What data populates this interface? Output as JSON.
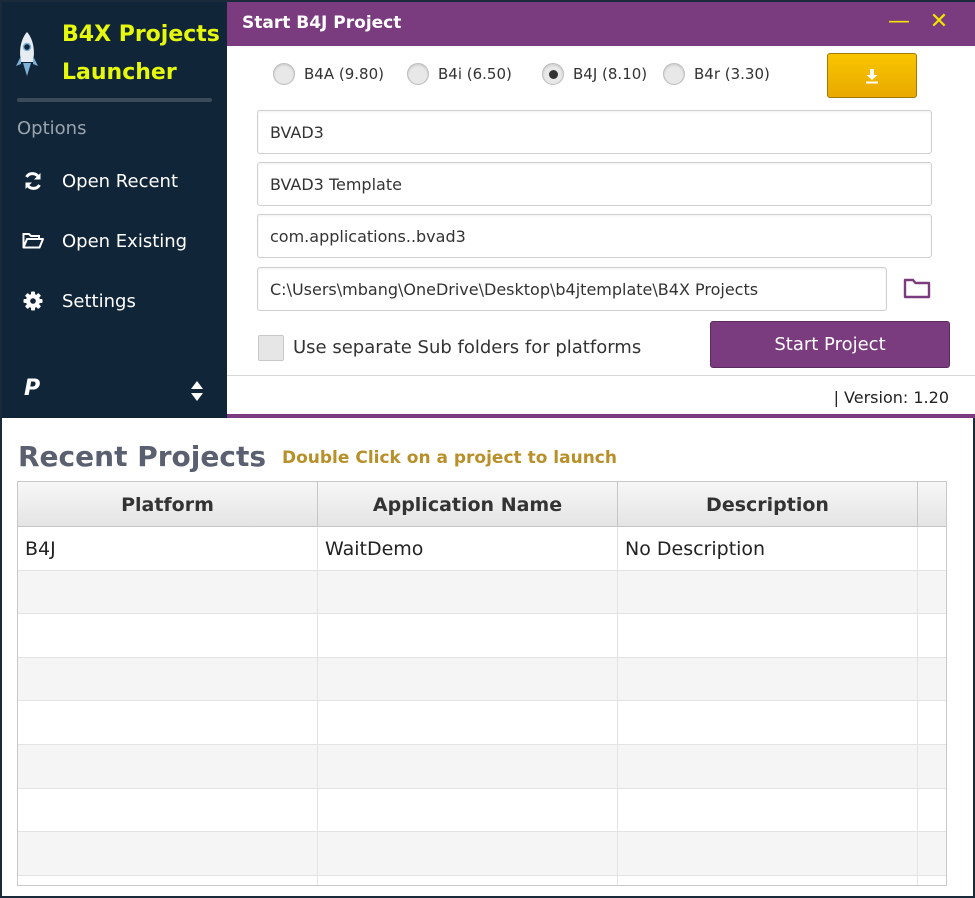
{
  "sidebar": {
    "app_title": "B4X Projects Launcher",
    "options_label": "Options",
    "items": [
      {
        "label": "Open Recent",
        "icon": "refresh-icon"
      },
      {
        "label": "Open Existing",
        "icon": "folder-open-icon"
      },
      {
        "label": "Settings",
        "icon": "gear-icon"
      }
    ],
    "paypal_icon": "P"
  },
  "dialog": {
    "title": "Start B4J Project",
    "minimize_glyph": "—",
    "close_glyph": "✕",
    "platforms": [
      {
        "label": "B4A (9.80)",
        "selected": false
      },
      {
        "label": "B4i (6.50)",
        "selected": false
      },
      {
        "label": "B4J (8.10)",
        "selected": true
      },
      {
        "label": "B4r (3.30)",
        "selected": false
      }
    ],
    "fields": {
      "project_name": "BVAD3",
      "description": "BVAD3 Template",
      "package": "com.applications..bvad3",
      "folder": "C:\\Users\\mbang\\OneDrive\\Desktop\\b4jtemplate\\B4X Projects"
    },
    "separate_folders_label": "Use separate Sub folders for platforms",
    "start_label": "Start Project",
    "version": "| Version: 1.20"
  },
  "recent": {
    "title": "Recent Projects",
    "hint": "Double Click on a project to launch",
    "columns": [
      "Platform",
      "Application Name",
      "Description"
    ],
    "rows": [
      [
        "B4J",
        "WaitDemo",
        "No Description"
      ],
      [
        "",
        "",
        ""
      ],
      [
        "",
        "",
        ""
      ],
      [
        "",
        "",
        ""
      ],
      [
        "",
        "",
        ""
      ],
      [
        "",
        "",
        ""
      ],
      [
        "",
        "",
        ""
      ],
      [
        "",
        "",
        ""
      ],
      [
        "",
        "",
        ""
      ]
    ]
  },
  "colors": {
    "sidebar_bg": "#112538",
    "accent_purple": "#7a3c7e",
    "title_yellow": "#e5f80d",
    "download_yellow": "#f2b800",
    "hint_gold": "#b8902a"
  }
}
